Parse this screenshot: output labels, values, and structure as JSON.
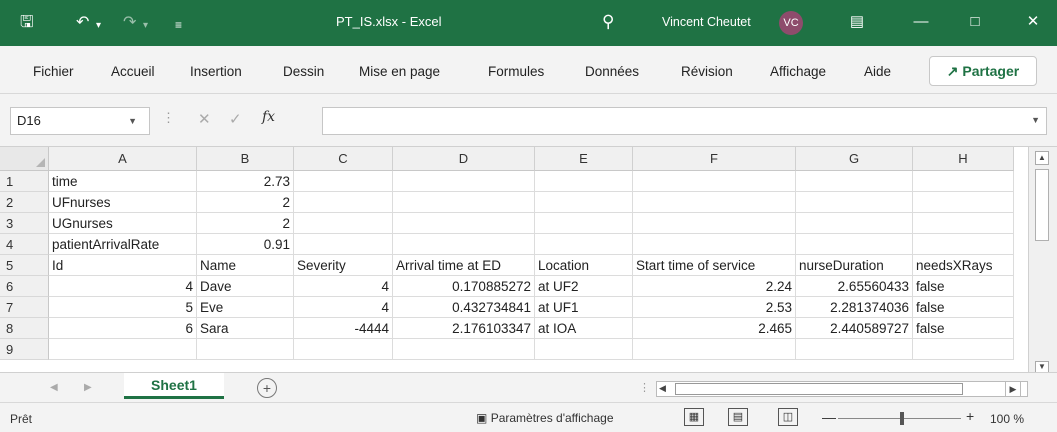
{
  "titlebar": {
    "filename": "PT_IS.xlsx",
    "separator": "-",
    "app": "Excel",
    "user_name": "Vincent Cheutet",
    "user_initials": "VC",
    "bg_color": "#1f7244"
  },
  "menu": {
    "items": [
      "Fichier",
      "Accueil",
      "Insertion",
      "Dessin",
      "Mise en page",
      "Formules",
      "Données",
      "Révision",
      "Affichage",
      "Aide"
    ],
    "share_label": "Partager"
  },
  "formula_bar": {
    "name_box": "D16",
    "formula": ""
  },
  "sheet": {
    "columns": [
      "A",
      "B",
      "C",
      "D",
      "E",
      "F",
      "G",
      "H"
    ],
    "rows": [
      {
        "num": "1",
        "cells": [
          "time",
          "2.73",
          "",
          "",
          "",
          "",
          "",
          ""
        ]
      },
      {
        "num": "2",
        "cells": [
          "UFnurses",
          "2",
          "",
          "",
          "",
          "",
          "",
          ""
        ]
      },
      {
        "num": "3",
        "cells": [
          "UGnurses",
          "2",
          "",
          "",
          "",
          "",
          "",
          ""
        ]
      },
      {
        "num": "4",
        "cells": [
          "patientArrivalRate",
          "0.91",
          "",
          "",
          "",
          "",
          "",
          ""
        ]
      },
      {
        "num": "5",
        "cells": [
          "Id",
          "Name",
          "Severity",
          "Arrival time at ED",
          "Location",
          "Start time of service",
          "nurseDuration",
          "needsXRays"
        ]
      },
      {
        "num": "6",
        "cells": [
          "4",
          "Dave",
          "4",
          "0.170885272",
          "at UF2",
          "2.24",
          "2.65560433",
          "false"
        ]
      },
      {
        "num": "7",
        "cells": [
          "5",
          "Eve",
          "4",
          "0.432734841",
          "at UF1",
          "2.53",
          "2.281374036",
          "false"
        ]
      },
      {
        "num": "8",
        "cells": [
          "6",
          "Sara",
          "-4444",
          "2.176103347",
          "at IOA",
          "2.465",
          "2.440589727",
          "false"
        ]
      },
      {
        "num": "9",
        "cells": [
          "",
          "",
          "",
          "",
          "",
          "",
          "",
          ""
        ]
      }
    ],
    "tab_name": "Sheet1"
  },
  "status": {
    "ready": "Prêt",
    "display_settings": "Paramètres d'affichage",
    "zoom": "100 %",
    "zoom_percent": 100
  }
}
